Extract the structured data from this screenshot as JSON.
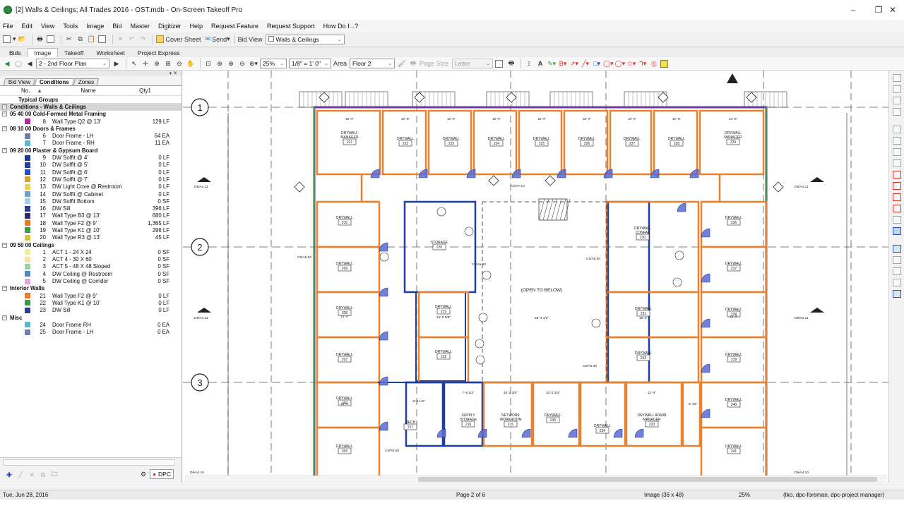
{
  "window": {
    "title": "[2] Walls & Ceilings; All Trades 2016 - OST.mdb - On-Screen Takeoff Pro",
    "minimize": "–",
    "restore": "❐",
    "close": "✕"
  },
  "menu": [
    "File",
    "Edit",
    "View",
    "Tools",
    "Image",
    "Bid",
    "Master",
    "Digitizer",
    "Help",
    "Request Feature",
    "Request Support",
    "How Do I...?"
  ],
  "toolbar1": {
    "cover_sheet": "Cover Sheet",
    "send": "Send",
    "bid_view_label": "Bid View",
    "bid_view_value": "Walls & Ceilings"
  },
  "tabs": [
    "Bids",
    "Image",
    "Takeoff",
    "Worksheet",
    "Project Express"
  ],
  "toolbar2": {
    "page": "2 - 2nd Floor Plan",
    "zoom": "25%",
    "scale": "1/8\" = 1' 0\"",
    "area_label": "Area",
    "area": "Floor 2",
    "page_size_label": "Page Size",
    "page_size": "Letter"
  },
  "left_panel": {
    "tabs": [
      "Bid View",
      "Conditions",
      "Zones"
    ],
    "columns": {
      "no": "No.",
      "name": "Name",
      "qty": "Qty1"
    },
    "rows": [
      {
        "t": "label",
        "name": "Typical Groups"
      },
      {
        "t": "sel",
        "name": "Conditions - Walls & Ceilings"
      },
      {
        "t": "group",
        "name": "05 40 00 Cold-Formed Metal Framing"
      },
      {
        "t": "item",
        "no": "8",
        "name": "Wall Type Q2 @ 13'",
        "qty": "129 LF",
        "color": "#b0289a"
      },
      {
        "t": "group",
        "name": "08 10 00 Doors & Frames"
      },
      {
        "t": "item",
        "no": "6",
        "name": "Door Frame - LH",
        "qty": "64 EA",
        "color": "#6a7fb0"
      },
      {
        "t": "item",
        "no": "7",
        "name": "Door Frame - RH",
        "qty": "11 EA",
        "color": "#5fb8c9"
      },
      {
        "t": "group",
        "name": "09 20 00 Plaster & Gypsum Board"
      },
      {
        "t": "item",
        "no": "9",
        "name": "DW Soffit @ 4'",
        "qty": "0 LF",
        "color": "#1d3c8e"
      },
      {
        "t": "item",
        "no": "10",
        "name": "DW Soffit @ 5'",
        "qty": "0 LF",
        "color": "#27419a"
      },
      {
        "t": "item",
        "no": "11",
        "name": "DW Soffit @ 6'",
        "qty": "0 LF",
        "color": "#2a4fb8"
      },
      {
        "t": "item",
        "no": "12",
        "name": "DW Soffit @ 7'",
        "qty": "0 LF",
        "color": "#d6a22c"
      },
      {
        "t": "item",
        "no": "13",
        "name": "DW Light Cove @ Restroom",
        "qty": "0 LF",
        "color": "#e9d25b"
      },
      {
        "t": "item",
        "no": "14",
        "name": "DW Soffit @ Cabinet",
        "qty": "0 LF",
        "color": "#6aa0cf"
      },
      {
        "t": "item",
        "no": "15",
        "name": "DW Soffit Bottom",
        "qty": "0 SF",
        "color": "#a8cde6"
      },
      {
        "t": "item",
        "no": "16",
        "name": "DW Sill",
        "qty": "396 LF",
        "color": "#2d3f94"
      },
      {
        "t": "item",
        "no": "17",
        "name": "Wall Type B3 @ 13'",
        "qty": "680 LF",
        "color": "#2c2b7a"
      },
      {
        "t": "item",
        "no": "18",
        "name": "Wall Type F2 @ 9'",
        "qty": "1,365 LF",
        "color": "#e87b2a"
      },
      {
        "t": "item",
        "no": "19",
        "name": "Wall Type K1 @ 10'",
        "qty": "296 LF",
        "color": "#3c9a48"
      },
      {
        "t": "item",
        "no": "20",
        "name": "Wall Type R3 @ 13'",
        "qty": "45 LF",
        "color": "#d8c33a"
      },
      {
        "t": "group",
        "name": "09 50 00 Ceilings"
      },
      {
        "t": "item",
        "no": "1",
        "name": "ACT 1 - 24 X 24",
        "qty": "0 SF",
        "color": "#eded9e"
      },
      {
        "t": "item",
        "no": "2",
        "name": "ACT 4 - 30 X 60",
        "qty": "0 SF",
        "color": "#f1e6a8"
      },
      {
        "t": "item",
        "no": "3",
        "name": "ACT 5 - 48 X 48 Sloped",
        "qty": "0 SF",
        "color": "#9ad1a0"
      },
      {
        "t": "item",
        "no": "4",
        "name": "DW Ceiling @ Restroom",
        "qty": "0 SF",
        "color": "#4c88c4"
      },
      {
        "t": "item",
        "no": "5",
        "name": "DW Ceiling @ Corridor",
        "qty": "0 SF",
        "color": "#e0a8d8"
      },
      {
        "t": "group",
        "name": "Interior Walls"
      },
      {
        "t": "item",
        "no": "21",
        "name": "Wall Type F2 @ 9'",
        "qty": "0 LF",
        "color": "#e87b2a"
      },
      {
        "t": "item",
        "no": "22",
        "name": "Wall Type K1 @ 10'",
        "qty": "0 LF",
        "color": "#3c9a48"
      },
      {
        "t": "item",
        "no": "23",
        "name": "DW Sill",
        "qty": "0 LF",
        "color": "#2d3f94"
      },
      {
        "t": "group",
        "name": "Misc"
      },
      {
        "t": "item",
        "no": "24",
        "name": "Door Frame RH",
        "qty": "0 EA",
        "color": "#5fb8c9"
      },
      {
        "t": "item",
        "no": "25",
        "name": "Door Frame - LH",
        "qty": "0 EA",
        "color": "#6a7fb0"
      }
    ],
    "dpc": "DPC"
  },
  "drawing": {
    "grid_labels": [
      "1",
      "2",
      "3"
    ],
    "open_to_below": "(OPEN TO BELOW)",
    "rooms": [
      {
        "l1": "DRYWALL",
        "l2": "MANAGER",
        "num": "221"
      },
      {
        "l1": "DRYWALL",
        "num": "222"
      },
      {
        "l1": "DRYWALL",
        "num": "223"
      },
      {
        "l1": "DRYWALL",
        "num": "224"
      },
      {
        "l1": "DRYWALL",
        "num": "225"
      },
      {
        "l1": "DRYWALL",
        "num": "226"
      },
      {
        "l1": "DRYWALL",
        "num": "227"
      },
      {
        "l1": "DRYWALL",
        "num": "228"
      },
      {
        "l1": "DRYWALL",
        "l2": "MANAGER",
        "num": "229"
      },
      {
        "l1": "DRYWALL",
        "num": "210"
      },
      {
        "l1": "DRYWALL",
        "num": "209"
      },
      {
        "l1": "DRYWALL",
        "num": "208"
      },
      {
        "l1": "DRYWALL",
        "num": "207"
      },
      {
        "l1": "DRYWALL",
        "num": "206"
      },
      {
        "l1": "DRYWALL",
        "num": "205"
      },
      {
        "l1": "STORAGE",
        "num": "220"
      },
      {
        "l1": "DRYWALL",
        "num": "219"
      },
      {
        "l1": "DRYWALL",
        "num": "218"
      },
      {
        "l1": "DRYWALL",
        "l2": "CONFAB",
        "num": "230"
      },
      {
        "l1": "DRYWALL",
        "num": "231"
      },
      {
        "l1": "DRYWALL",
        "num": "232"
      },
      {
        "l1": "DRYWALL",
        "num": "236"
      },
      {
        "l1": "DRYWALL",
        "num": "237"
      },
      {
        "l1": "DRYWALL",
        "num": "238"
      },
      {
        "l1": "DRYWALL",
        "num": "239"
      },
      {
        "l1": "DRYWALL",
        "num": "240"
      },
      {
        "l1": "DRYWALL",
        "num": "241"
      },
      {
        "l1": "SUPPLY",
        "l2": "STORAGE",
        "num": "216"
      },
      {
        "l1": "NETWORK",
        "l2": "WORKROOM",
        "num": "215"
      },
      {
        "l1": "DRYWALL",
        "num": "235"
      },
      {
        "l1": "DRYWALL",
        "num": "234"
      },
      {
        "l1": "DRYWALL ADMIN",
        "l2": "MANAGER",
        "num": "233"
      },
      {
        "l1": "MECH",
        "num": "217"
      }
    ],
    "dims": [
      "15'-0\"",
      "10'-0\"",
      "10'-0\"",
      "10'-0\"",
      "10'-0\"",
      "10'-0\"",
      "10'-0\"",
      "10'-0\"",
      "14'-8\"",
      "28'-4 1/2\"",
      "14'-4\"",
      "15'-2\"",
      "15'-0 5/8\"",
      "12'-2\"",
      "10'-2 3/4\"",
      "10'-2 3/4\"",
      "11'-4\"",
      "14'-4\"",
      "5'-10\"",
      "8'-8 1/2\"",
      "7'-9 1/2\""
    ],
    "elev_tags": [
      "D9/A4.11",
      "D9/A4.11",
      "D9/A4.11",
      "D9/A4.11",
      "A4/A7.10",
      "C5/A5.30",
      "C5/A5.30",
      "C6/A5.30",
      "C5/A5.30",
      "D6/A4.10",
      "C6/R2.60",
      "D9/A4.10"
    ]
  },
  "status": {
    "date": "Tue, Jun 28, 2016",
    "page": "Page 2 of 6",
    "image": "Image (36 x 48)",
    "zoom": "25%",
    "users": "(tko, dpc-foreman, dpc-project manager)"
  }
}
